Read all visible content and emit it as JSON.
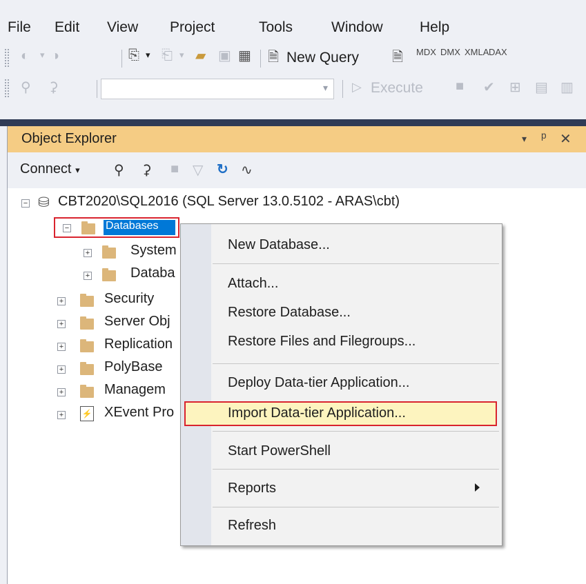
{
  "menu": [
    "File",
    "Edit",
    "View",
    "Project",
    "Tools",
    "Window",
    "Help"
  ],
  "toolbar1": {
    "new_query_label": "New Query",
    "query_types": [
      "MDX",
      "DMX",
      "XMLA",
      "DAX"
    ]
  },
  "toolbar2": {
    "database_combo_value": "",
    "execute_label": "Execute"
  },
  "object_explorer": {
    "title": "Object Explorer",
    "window_controls": [
      "▾",
      "ᵖ",
      "✕"
    ],
    "connect_label": "Connect",
    "tree": {
      "server": "CBT2020\\SQL2016 (SQL Server 13.0.5102 - ARAS\\cbt)",
      "databases": "Databases",
      "system_databases": "System",
      "database_snapshots": "Databa",
      "security": "Security",
      "server_objects": "Server Obj",
      "replication": "Replication",
      "polybase": "PolyBase",
      "management": "Managem",
      "xevent": "XEvent Pro"
    }
  },
  "context_menu": {
    "items": [
      "New Database...",
      "Attach...",
      "Restore Database...",
      "Restore Files and Filegroups...",
      "Deploy Data-tier Application...",
      "Import Data-tier Application...",
      "Start PowerShell",
      "Reports",
      "Refresh"
    ],
    "highlighted": "Import Data-tier Application..."
  },
  "colors": {
    "title_bar": "#f5cc84",
    "selection": "#0078d7",
    "highlight_border": "#d9232e",
    "folder": "#dcb67a"
  }
}
